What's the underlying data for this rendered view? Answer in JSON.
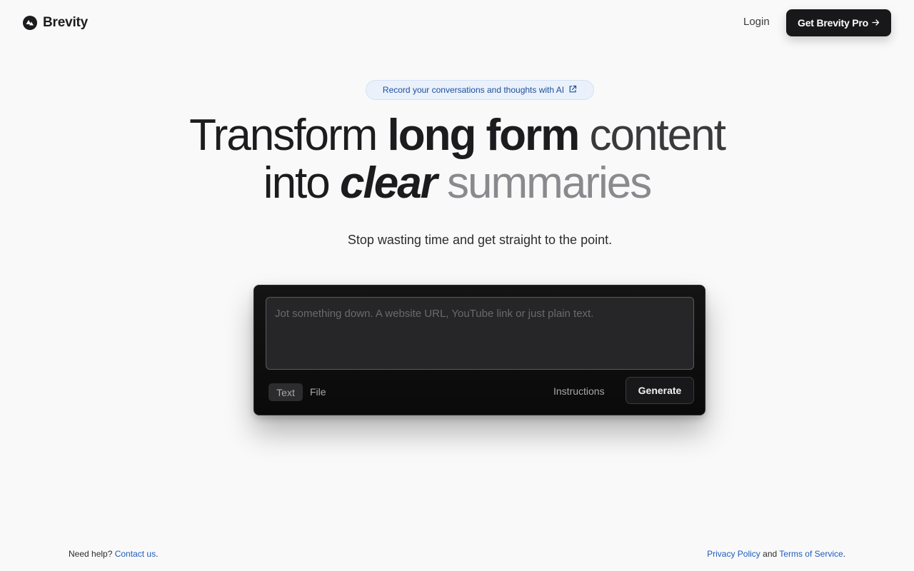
{
  "header": {
    "brand_name": "Brevity",
    "login_label": "Login",
    "pro_button_label": "Get Brevity Pro",
    "pro_button_icon": "arrow-right-icon"
  },
  "hero": {
    "pill_text": "Record your conversations and thoughts with AI",
    "pill_icon": "external-link-icon",
    "headline": {
      "l1_a": "Transform ",
      "l1_b": "long form",
      "l1_c": " content",
      "l2_a": "into ",
      "l2_b": "clear",
      "l2_c": " summaries"
    },
    "subline": "Stop wasting time and get straight to the point."
  },
  "composer": {
    "placeholder": "Jot something down. A website URL, YouTube link or just plain text.",
    "value": "",
    "mode_text_label": "Text",
    "mode_file_label": "File",
    "instructions_label": "Instructions",
    "generate_label": "Generate",
    "active_mode": "Text"
  },
  "footer": {
    "help_prefix": "Need help? ",
    "contact_label": "Contact us",
    "contact_suffix": ".",
    "privacy_label": "Privacy Policy",
    "and_text": " and ",
    "terms_label": "Terms of Service",
    "terms_suffix": "."
  },
  "colors": {
    "background": "#f9f9f9",
    "primary_dark": "#18181a",
    "link_blue": "#1f5bbf",
    "pill_bg": "#eaf1fb"
  }
}
